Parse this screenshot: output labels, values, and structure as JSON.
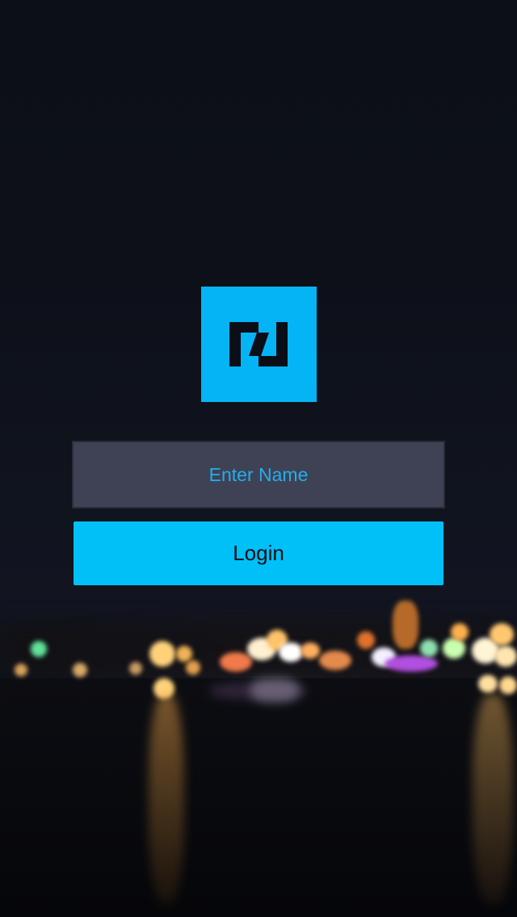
{
  "login_form": {
    "name_placeholder": "Enter Name",
    "name_value": "",
    "login_label": "Login"
  },
  "logo": {
    "icon": "app-logo-icon",
    "background_color": "#05b4f5",
    "glyph_color": "#0b0e16"
  },
  "colors": {
    "accent": "#00c0f8",
    "input_background": "#3f4254",
    "placeholder_text": "#22aef0",
    "page_background": "#0b0e16"
  }
}
